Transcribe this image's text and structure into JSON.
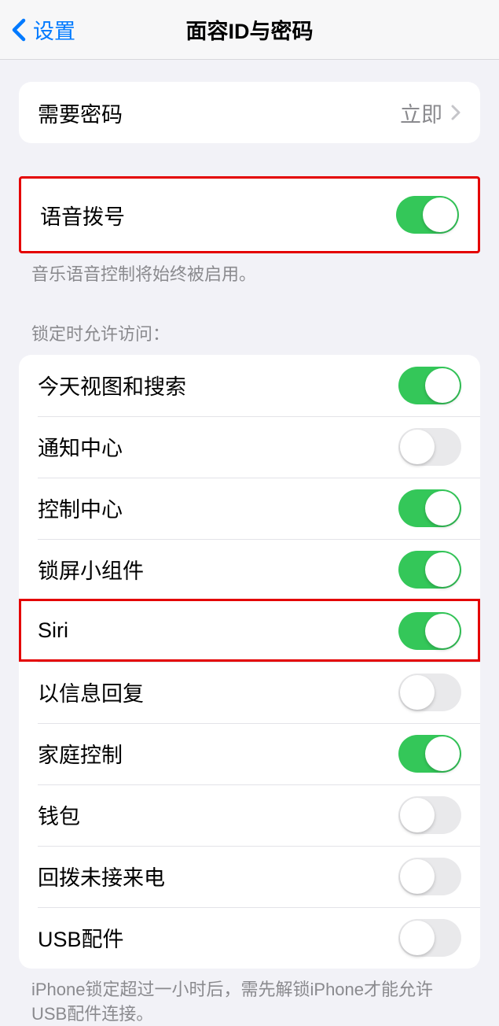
{
  "nav": {
    "back_label": "设置",
    "title": "面容ID与密码"
  },
  "passcode": {
    "label": "需要密码",
    "value": "立即"
  },
  "voice_dial": {
    "label": "语音拨号",
    "on": true,
    "footer": "音乐语音控制将始终被启用。"
  },
  "lock_access": {
    "header": "锁定时允许访问：",
    "items": [
      {
        "label": "今天视图和搜索",
        "on": true
      },
      {
        "label": "通知中心",
        "on": false
      },
      {
        "label": "控制中心",
        "on": true
      },
      {
        "label": "锁屏小组件",
        "on": true
      },
      {
        "label": "Siri",
        "on": true
      },
      {
        "label": "以信息回复",
        "on": false
      },
      {
        "label": "家庭控制",
        "on": true
      },
      {
        "label": "钱包",
        "on": false
      },
      {
        "label": "回拨未接来电",
        "on": false
      },
      {
        "label": "USB配件",
        "on": false
      }
    ],
    "footer": "iPhone锁定超过一小时后，需先解锁iPhone才能允许USB配件连接。"
  }
}
